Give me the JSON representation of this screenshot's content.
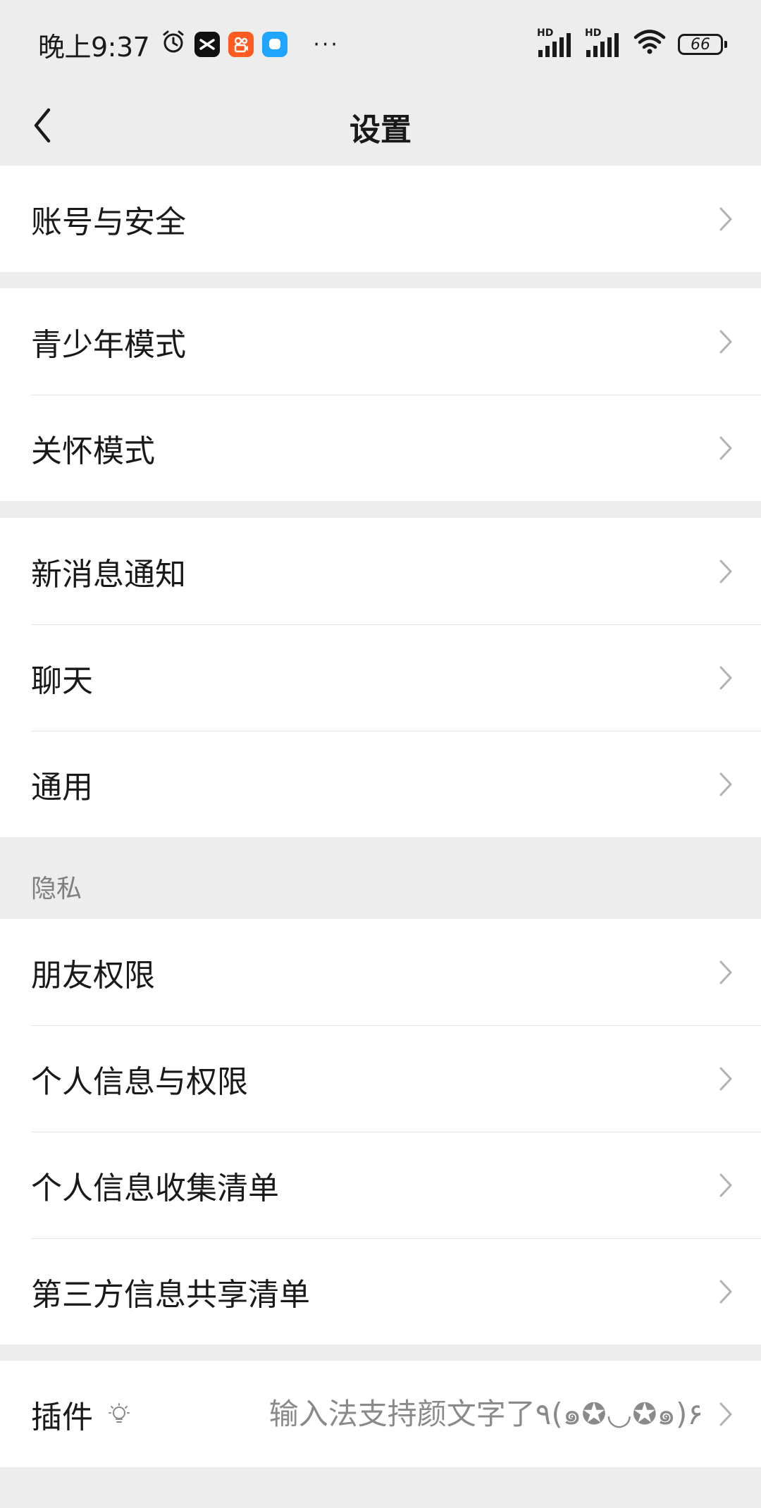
{
  "status_bar": {
    "time": "晚上9:37",
    "more": "···",
    "hd1": "HD",
    "hd2": "HD",
    "battery": "66",
    "icons": [
      "alarm-icon",
      "capcut-app-icon",
      "kuaishou-app-icon",
      "chat-app-icon",
      "signal-icon",
      "signal-icon",
      "wifi-icon",
      "battery-icon"
    ],
    "colors": {
      "capcut": "#111111",
      "kuaishou": "#ff5a1f",
      "chat": "#1fa4ff"
    }
  },
  "nav": {
    "title": "设置",
    "back_icon": "chevron-left-icon"
  },
  "groups": {
    "account": {
      "items": [
        {
          "label": "账号与安全"
        }
      ]
    },
    "modes": {
      "items": [
        {
          "label": "青少年模式"
        },
        {
          "label": "关怀模式"
        }
      ]
    },
    "general": {
      "items": [
        {
          "label": "新消息通知"
        },
        {
          "label": "聊天"
        },
        {
          "label": "通用"
        }
      ]
    },
    "privacy": {
      "section_label": "隐私",
      "items": [
        {
          "label": "朋友权限"
        },
        {
          "label": "个人信息与权限"
        },
        {
          "label": "个人信息收集清单"
        },
        {
          "label": "第三方信息共享清单"
        }
      ]
    },
    "plugins": {
      "items": [
        {
          "label": "插件",
          "icon": "lightbulb-icon",
          "hint": "输入法支持颜文字了٩(๑✪◡✪๑)۶"
        }
      ]
    }
  },
  "theme": {
    "background": "#ededed",
    "card": "#ffffff",
    "text": "#191919",
    "secondary": "#7f7f7f"
  }
}
